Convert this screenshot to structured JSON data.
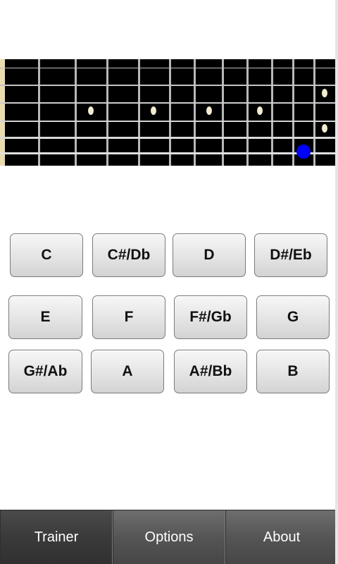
{
  "notes": [
    {
      "label": "C"
    },
    {
      "label": "C#/Db"
    },
    {
      "label": "D"
    },
    {
      "label": "D#/Eb"
    },
    {
      "label": "E"
    },
    {
      "label": "F"
    },
    {
      "label": "F#/Gb"
    },
    {
      "label": "G"
    },
    {
      "label": "G#/Ab"
    },
    {
      "label": "A"
    },
    {
      "label": "A#/Bb"
    },
    {
      "label": "B"
    }
  ],
  "tabs": [
    {
      "label": "Trainer",
      "active": true
    },
    {
      "label": "Options",
      "active": false
    },
    {
      "label": "About",
      "active": false
    }
  ],
  "fretboard": {
    "board_color": "#000000",
    "string_color": "#d6d6d6",
    "fret_color": "#b8b8b8",
    "nut_color": "#e8dcb0",
    "inlay_color": "#f2ebcf",
    "marker_color": "#0000ff"
  }
}
